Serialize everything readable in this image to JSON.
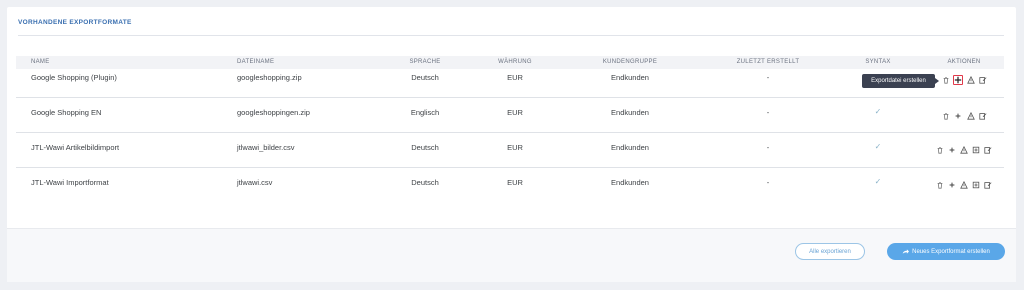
{
  "section": {
    "title": "VORHANDENE EXPORTFORMATE"
  },
  "table": {
    "headers": {
      "name": "NAME",
      "dateiname": "DATEINAME",
      "sprache": "SPRACHE",
      "waehrung": "WÄHRUNG",
      "kundengruppe": "KUNDENGRUPPE",
      "zuletzt": "ZULETZT ERSTELLT",
      "syntax": "SYNTAX",
      "aktionen": "AKTIONEN"
    },
    "rows": [
      {
        "name": "Google Shopping (Plugin)",
        "dateiname": "googleshopping.zip",
        "sprache": "Deutsch",
        "waehrung": "EUR",
        "kundengruppe": "Endkunden",
        "zuletzt": "-",
        "syntax": ""
      },
      {
        "name": "Google Shopping EN",
        "dateiname": "googleshoppingen.zip",
        "sprache": "Englisch",
        "waehrung": "EUR",
        "kundengruppe": "Endkunden",
        "zuletzt": "-",
        "syntax": "✓"
      },
      {
        "name": "JTL-Wawi Artikelbildimport",
        "dateiname": "jtlwawi_bilder.csv",
        "sprache": "Deutsch",
        "waehrung": "EUR",
        "kundengruppe": "Endkunden",
        "zuletzt": "-",
        "syntax": "✓"
      },
      {
        "name": "JTL-Wawi Importformat",
        "dateiname": "jtlwawi.csv",
        "sprache": "Deutsch",
        "waehrung": "EUR",
        "kundengruppe": "Endkunden",
        "zuletzt": "-",
        "syntax": "✓"
      }
    ]
  },
  "tooltip": {
    "text": "Exportdatei erstellen"
  },
  "footer": {
    "export_all": "Alle exportieren",
    "new_format": "Neues Exportformat erstellen"
  },
  "colors": {
    "accent": "#5aa7e8",
    "active_border": "#e0394a",
    "tooltip_bg": "#3b4151"
  }
}
